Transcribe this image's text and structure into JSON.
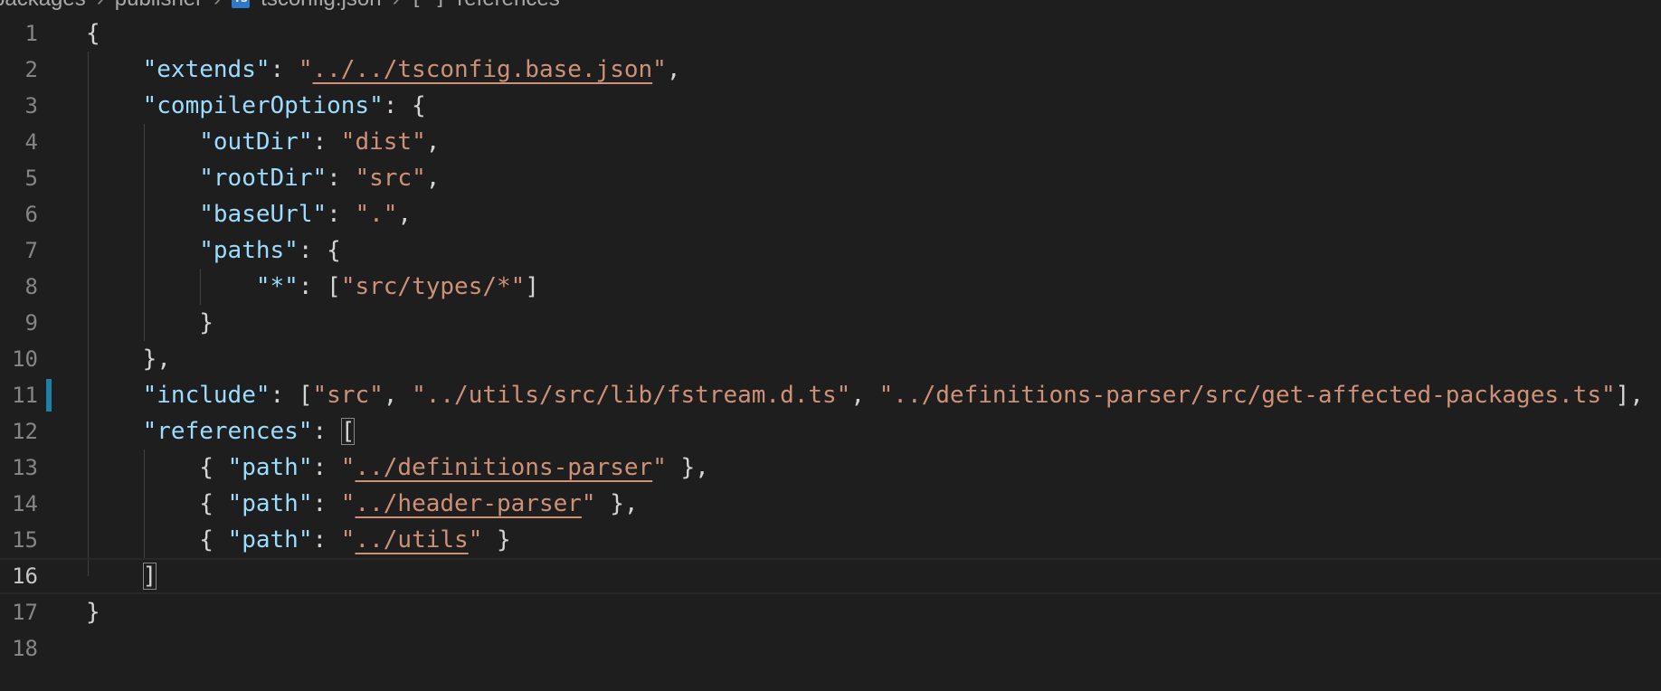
{
  "breadcrumb": {
    "items": [
      "packages",
      "publisher",
      "tsconfig.json",
      "references"
    ],
    "file_icon": "ts-file-icon",
    "symbol_icon": "array-brackets-icon"
  },
  "editor": {
    "line_numbers": [
      "1",
      "2",
      "3",
      "4",
      "5",
      "6",
      "7",
      "8",
      "9",
      "10",
      "11",
      "12",
      "13",
      "14",
      "15",
      "16",
      "17",
      "18"
    ],
    "active_line": 16,
    "modified_line": 11,
    "lines": [
      "{",
      "    \"extends\": \"../../tsconfig.base.json\",",
      "    \"compilerOptions\": {",
      "        \"outDir\": \"dist\",",
      "        \"rootDir\": \"src\",",
      "        \"baseUrl\": \".\",",
      "        \"paths\": {",
      "            \"*\": [\"src/types/*\"]",
      "        }",
      "    },",
      "    \"include\": [\"src\", \"../utils/src/lib/fstream.d.ts\", \"../definitions-parser/src/get-affected-packages.ts\"],",
      "    \"references\": [",
      "        { \"path\": \"../definitions-parser\" },",
      "        { \"path\": \"../header-parser\" },",
      "        { \"path\": \"../utils\" }",
      "    ]",
      "}",
      ""
    ]
  },
  "colors": {
    "background": "#1e1e1e",
    "key": "#9cdcfe",
    "string": "#ce9178",
    "punctuation": "#d4d4d4",
    "line_number": "#858585",
    "modified_marker": "#1b81a8"
  }
}
